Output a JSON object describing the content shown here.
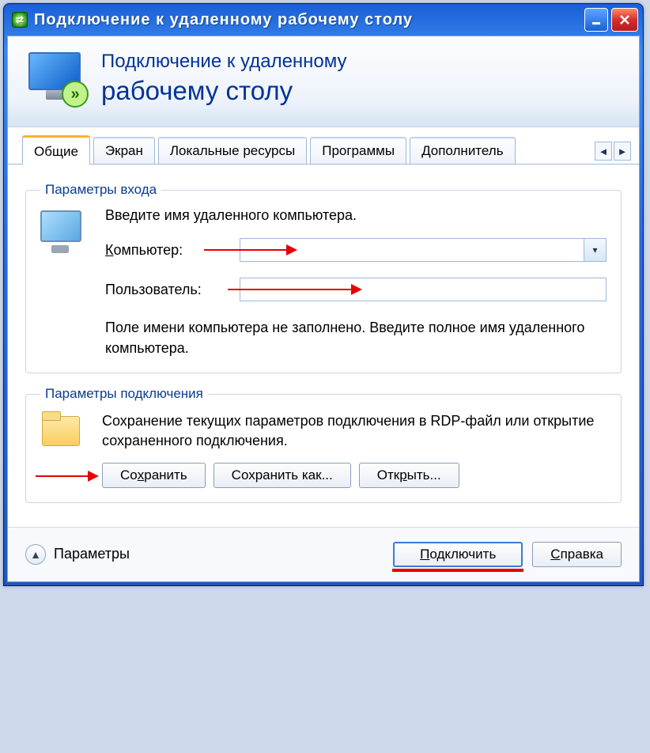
{
  "window": {
    "title": "Подключение к удаленному рабочему столу"
  },
  "header": {
    "line1": "Подключение к удаленному",
    "line2": "рабочему столу"
  },
  "tabs": {
    "items": [
      "Общие",
      "Экран",
      "Локальные ресурсы",
      "Программы",
      "Дополнитель"
    ],
    "active_index": 0
  },
  "login_group": {
    "legend": "Параметры входа",
    "instruction": "Введите имя удаленного компьютера.",
    "computer_label_pre": "К",
    "computer_label_rest": "омпьютер:",
    "computer_value": "",
    "user_label": "Пользователь:",
    "user_value": "",
    "hint": "Поле имени компьютера не заполнено. Введите полное имя удаленного компьютера."
  },
  "conn_group": {
    "legend": "Параметры подключения",
    "text": "Сохранение текущих параметров подключения в RDP-файл или открытие сохраненного подключения.",
    "save_pre": "Со",
    "save_u": "х",
    "save_post": "ранить",
    "saveas_label": "Сохранить как...",
    "open_pre": "Отк",
    "open_u": "р",
    "open_post": "ыть..."
  },
  "footer": {
    "params_pre": "Пара",
    "params_u": "м",
    "params_post": "етры",
    "connect_pre": "",
    "connect_u": "П",
    "connect_post": "одключить",
    "help_pre": "",
    "help_u": "С",
    "help_post": "правка"
  }
}
